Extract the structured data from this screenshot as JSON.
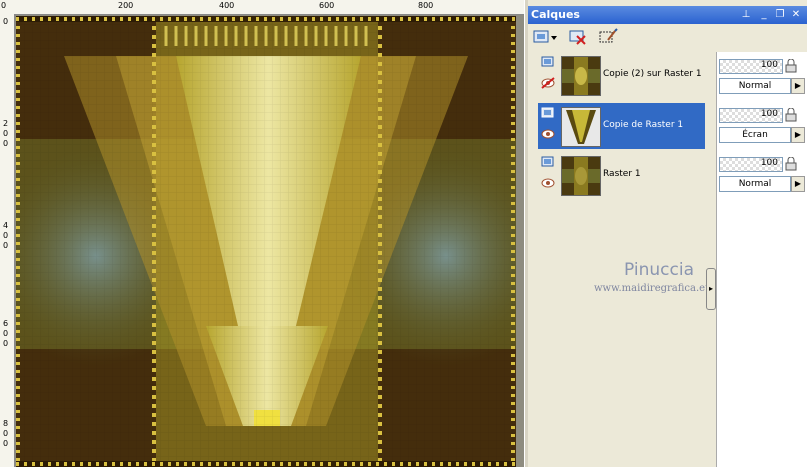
{
  "canvas": {
    "ruler_top_labels": [
      "200",
      "400",
      "600",
      "800"
    ],
    "ruler_left_labels": [
      "0",
      "2",
      "0",
      "0",
      "4",
      "0",
      "0",
      "6",
      "0",
      "0",
      "8",
      "0",
      "0"
    ]
  },
  "panel": {
    "title": "Calques",
    "title_buttons": [
      "pin-icon",
      "minimize-icon",
      "restore-icon",
      "close-icon"
    ],
    "toolbar": [
      "new-raster-layer-icon",
      "delete-layer-icon",
      "edit-selection-icon"
    ]
  },
  "layers": [
    {
      "name": "Copie (2) sur Raster 1",
      "opacity": "100",
      "blend": "Normal",
      "visible": false,
      "selected": false
    },
    {
      "name": "Copie de Raster 1",
      "opacity": "100",
      "blend": "Écran",
      "visible": true,
      "selected": true
    },
    {
      "name": "Raster 1",
      "opacity": "100",
      "blend": "Normal",
      "visible": true,
      "selected": false
    }
  ],
  "watermark": {
    "name": "Pinuccia",
    "site": "www.maidiregrafica.eu"
  },
  "colors": {
    "selection": "#316ac5",
    "title_bar": "#2a62d0",
    "gold": "#d8c840",
    "dark_brown": "#3a2608"
  }
}
